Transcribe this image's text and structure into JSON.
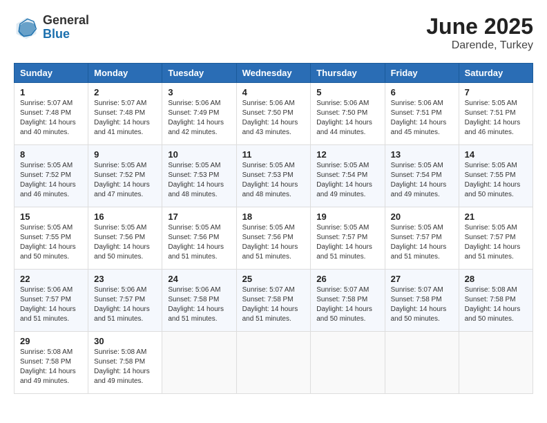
{
  "header": {
    "logo_line1": "General",
    "logo_line2": "Blue",
    "title": "June 2025",
    "subtitle": "Darende, Turkey"
  },
  "columns": [
    "Sunday",
    "Monday",
    "Tuesday",
    "Wednesday",
    "Thursday",
    "Friday",
    "Saturday"
  ],
  "weeks": [
    [
      {
        "day": "1",
        "info": "Sunrise: 5:07 AM\nSunset: 7:48 PM\nDaylight: 14 hours\nand 40 minutes."
      },
      {
        "day": "2",
        "info": "Sunrise: 5:07 AM\nSunset: 7:48 PM\nDaylight: 14 hours\nand 41 minutes."
      },
      {
        "day": "3",
        "info": "Sunrise: 5:06 AM\nSunset: 7:49 PM\nDaylight: 14 hours\nand 42 minutes."
      },
      {
        "day": "4",
        "info": "Sunrise: 5:06 AM\nSunset: 7:50 PM\nDaylight: 14 hours\nand 43 minutes."
      },
      {
        "day": "5",
        "info": "Sunrise: 5:06 AM\nSunset: 7:50 PM\nDaylight: 14 hours\nand 44 minutes."
      },
      {
        "day": "6",
        "info": "Sunrise: 5:06 AM\nSunset: 7:51 PM\nDaylight: 14 hours\nand 45 minutes."
      },
      {
        "day": "7",
        "info": "Sunrise: 5:05 AM\nSunset: 7:51 PM\nDaylight: 14 hours\nand 46 minutes."
      }
    ],
    [
      {
        "day": "8",
        "info": "Sunrise: 5:05 AM\nSunset: 7:52 PM\nDaylight: 14 hours\nand 46 minutes."
      },
      {
        "day": "9",
        "info": "Sunrise: 5:05 AM\nSunset: 7:52 PM\nDaylight: 14 hours\nand 47 minutes."
      },
      {
        "day": "10",
        "info": "Sunrise: 5:05 AM\nSunset: 7:53 PM\nDaylight: 14 hours\nand 48 minutes."
      },
      {
        "day": "11",
        "info": "Sunrise: 5:05 AM\nSunset: 7:53 PM\nDaylight: 14 hours\nand 48 minutes."
      },
      {
        "day": "12",
        "info": "Sunrise: 5:05 AM\nSunset: 7:54 PM\nDaylight: 14 hours\nand 49 minutes."
      },
      {
        "day": "13",
        "info": "Sunrise: 5:05 AM\nSunset: 7:54 PM\nDaylight: 14 hours\nand 49 minutes."
      },
      {
        "day": "14",
        "info": "Sunrise: 5:05 AM\nSunset: 7:55 PM\nDaylight: 14 hours\nand 50 minutes."
      }
    ],
    [
      {
        "day": "15",
        "info": "Sunrise: 5:05 AM\nSunset: 7:55 PM\nDaylight: 14 hours\nand 50 minutes."
      },
      {
        "day": "16",
        "info": "Sunrise: 5:05 AM\nSunset: 7:56 PM\nDaylight: 14 hours\nand 50 minutes."
      },
      {
        "day": "17",
        "info": "Sunrise: 5:05 AM\nSunset: 7:56 PM\nDaylight: 14 hours\nand 51 minutes."
      },
      {
        "day": "18",
        "info": "Sunrise: 5:05 AM\nSunset: 7:56 PM\nDaylight: 14 hours\nand 51 minutes."
      },
      {
        "day": "19",
        "info": "Sunrise: 5:05 AM\nSunset: 7:57 PM\nDaylight: 14 hours\nand 51 minutes."
      },
      {
        "day": "20",
        "info": "Sunrise: 5:05 AM\nSunset: 7:57 PM\nDaylight: 14 hours\nand 51 minutes."
      },
      {
        "day": "21",
        "info": "Sunrise: 5:05 AM\nSunset: 7:57 PM\nDaylight: 14 hours\nand 51 minutes."
      }
    ],
    [
      {
        "day": "22",
        "info": "Sunrise: 5:06 AM\nSunset: 7:57 PM\nDaylight: 14 hours\nand 51 minutes."
      },
      {
        "day": "23",
        "info": "Sunrise: 5:06 AM\nSunset: 7:57 PM\nDaylight: 14 hours\nand 51 minutes."
      },
      {
        "day": "24",
        "info": "Sunrise: 5:06 AM\nSunset: 7:58 PM\nDaylight: 14 hours\nand 51 minutes."
      },
      {
        "day": "25",
        "info": "Sunrise: 5:07 AM\nSunset: 7:58 PM\nDaylight: 14 hours\nand 51 minutes."
      },
      {
        "day": "26",
        "info": "Sunrise: 5:07 AM\nSunset: 7:58 PM\nDaylight: 14 hours\nand 50 minutes."
      },
      {
        "day": "27",
        "info": "Sunrise: 5:07 AM\nSunset: 7:58 PM\nDaylight: 14 hours\nand 50 minutes."
      },
      {
        "day": "28",
        "info": "Sunrise: 5:08 AM\nSunset: 7:58 PM\nDaylight: 14 hours\nand 50 minutes."
      }
    ],
    [
      {
        "day": "29",
        "info": "Sunrise: 5:08 AM\nSunset: 7:58 PM\nDaylight: 14 hours\nand 49 minutes."
      },
      {
        "day": "30",
        "info": "Sunrise: 5:08 AM\nSunset: 7:58 PM\nDaylight: 14 hours\nand 49 minutes."
      },
      null,
      null,
      null,
      null,
      null
    ]
  ]
}
